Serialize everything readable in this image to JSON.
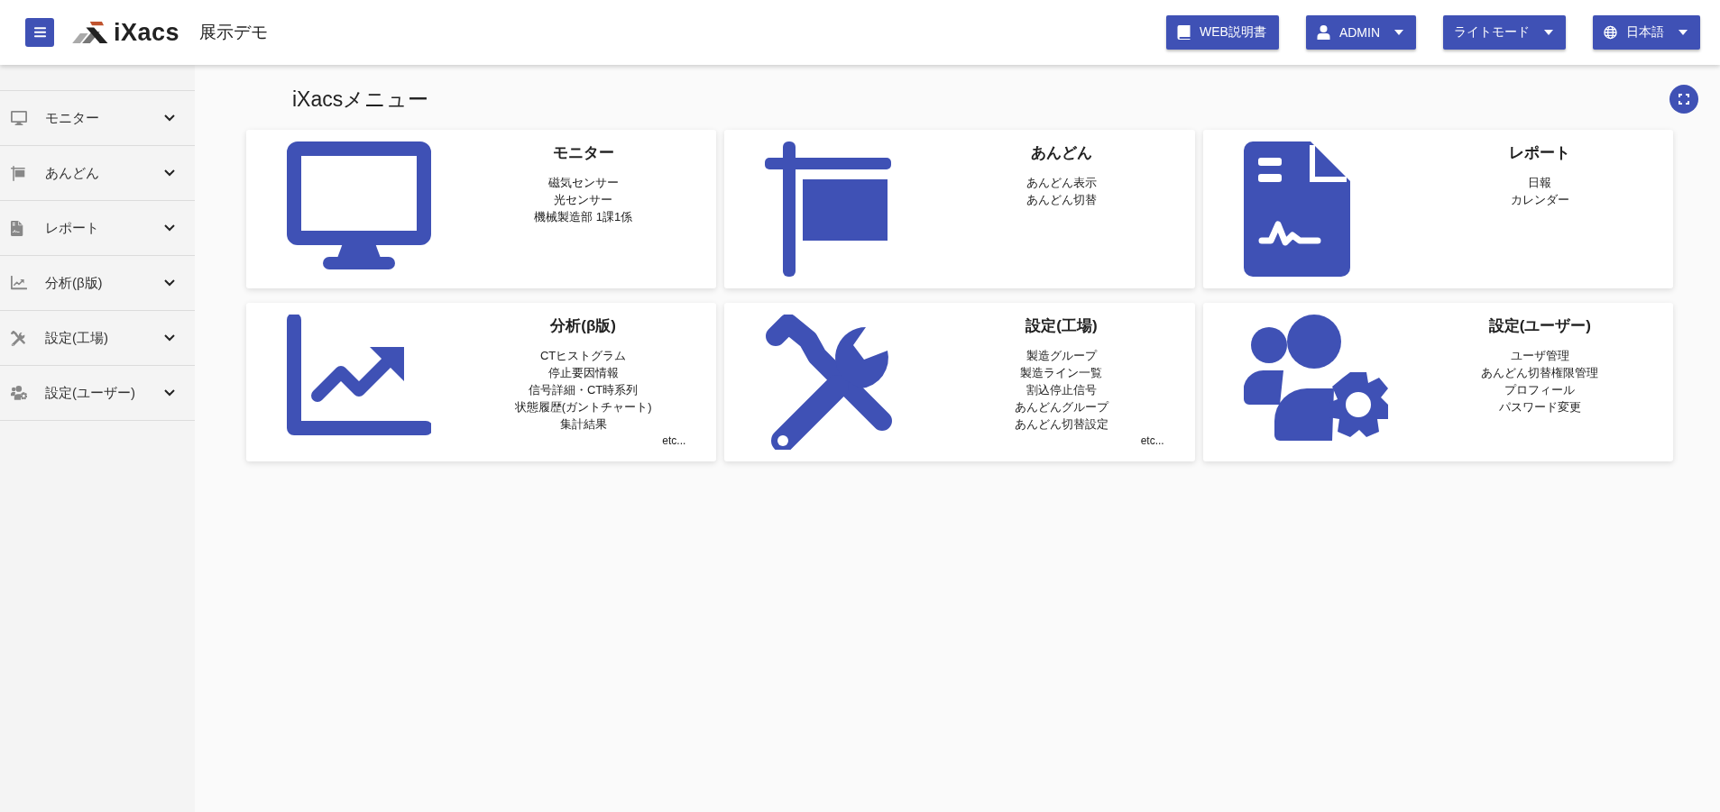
{
  "header": {
    "logo": "iXacs",
    "subtitle": "展示デモ",
    "buttons": [
      {
        "label": "WEB説明書",
        "kind": "book",
        "dropdown": false
      },
      {
        "label": "ADMIN",
        "kind": "user",
        "dropdown": true
      },
      {
        "label": "ライトモード",
        "kind": "plain",
        "dropdown": true
      },
      {
        "label": "日本語",
        "kind": "globe",
        "dropdown": true
      }
    ]
  },
  "sidebar": {
    "items": [
      {
        "label": "モニター",
        "kind": "monitor"
      },
      {
        "label": "あんどん",
        "kind": "flag"
      },
      {
        "label": "レポート",
        "kind": "report"
      },
      {
        "label": "分析(β版)",
        "kind": "chart"
      },
      {
        "label": "設定(工場)",
        "kind": "tools"
      },
      {
        "label": "設定(ユーザー)",
        "kind": "users"
      }
    ]
  },
  "page": {
    "title": "iXacsメニュー"
  },
  "cards": [
    {
      "title": "モニター",
      "kind": "monitor",
      "items": [
        "磁気センサー",
        "光センサー",
        "機械製造部 1課1係"
      ]
    },
    {
      "title": "あんどん",
      "kind": "flag",
      "items": [
        "あんどん表示",
        "あんどん切替"
      ]
    },
    {
      "title": "レポート",
      "kind": "report",
      "items": [
        "日報",
        "カレンダー"
      ]
    },
    {
      "title": "分析(β版)",
      "kind": "chart",
      "items": [
        "CTヒストグラム",
        "停止要因情報",
        "信号詳細・CT時系列",
        "状態履歴(ガントチャート)",
        "集計結果"
      ],
      "more": "etc..."
    },
    {
      "title": "設定(工場)",
      "kind": "tools",
      "items": [
        "製造グループ",
        "製造ライン一覧",
        "割込停止信号",
        "あんどんグループ",
        "あんどん切替設定"
      ],
      "more": "etc..."
    },
    {
      "title": "設定(ユーザー)",
      "kind": "users",
      "items": [
        "ユーザ管理",
        "あんどん切替権限管理",
        "プロフィール",
        "パスワード変更"
      ]
    }
  ]
}
